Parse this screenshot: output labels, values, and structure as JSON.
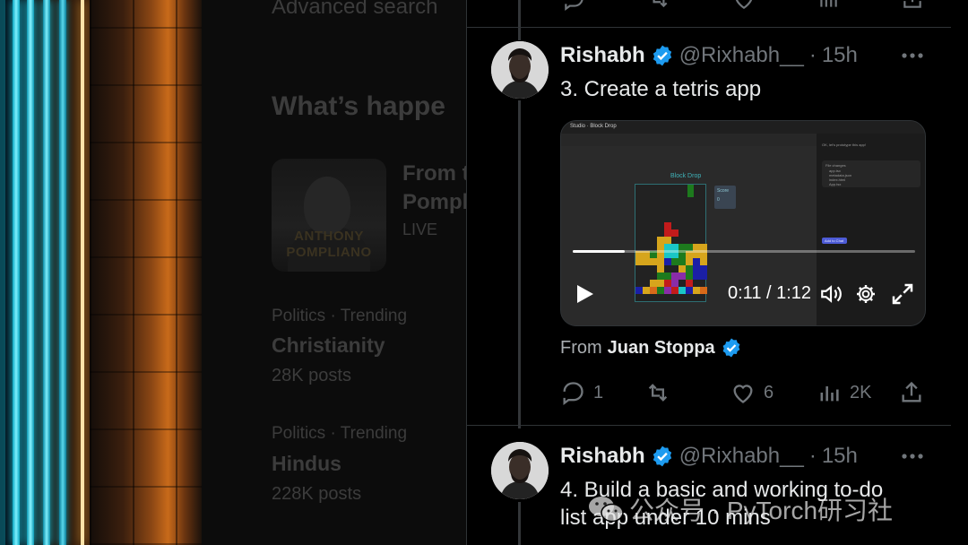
{
  "sidebar_right": {
    "search_label": "Advanced search",
    "section_title": "What’s happe",
    "news": {
      "headline_1": "From t",
      "headline_2": "Pompl",
      "status": "LIVE",
      "thumb_caption_1": "ANTHONY",
      "thumb_caption_2": "POMPLIANO"
    },
    "trends": [
      {
        "category": "Politics · Trending",
        "topic": "Christianity",
        "count": "28K posts"
      },
      {
        "category": "Politics · Trending",
        "topic": "Hindus",
        "count": "228K posts"
      }
    ]
  },
  "tweets": [
    {
      "name": "Rishabh",
      "handle": "@Rixhabh__",
      "separator": "·",
      "time": "15h",
      "text": "3. Create a tetris app",
      "video": {
        "app_bar_label": "Studio  ·  Block Drop",
        "game_title": "Block Drop",
        "score_label": "Score",
        "score_value": "0",
        "panel_intro": "OK, let's prototype this app!",
        "panel_header": "File changes",
        "panel_files": [
          "app.tsx",
          "metadata.json",
          "index.html",
          "App.tsx",
          "Component.tsx"
        ],
        "panel_button": "Add to Chat",
        "time_display": "0:11 / 1:12",
        "progress": 0.153
      },
      "source_prefix": "From",
      "source_name": "Juan Stoppa",
      "stats": {
        "replies": "1",
        "reposts": "",
        "likes": "6",
        "views": "2K"
      }
    },
    {
      "name": "Rishabh",
      "handle": "@Rixhabh__",
      "separator": "·",
      "time": "15h",
      "text_line_1": "4. Build a basic and working to-do",
      "text_line_2": "list app under 10 mins"
    }
  ],
  "watermark": "公众号 · PyTorch研习社",
  "colors": {
    "verified": "#1d9bf0",
    "background": "#000000",
    "text_primary": "#e7e9ea",
    "text_secondary": "#71767b"
  }
}
